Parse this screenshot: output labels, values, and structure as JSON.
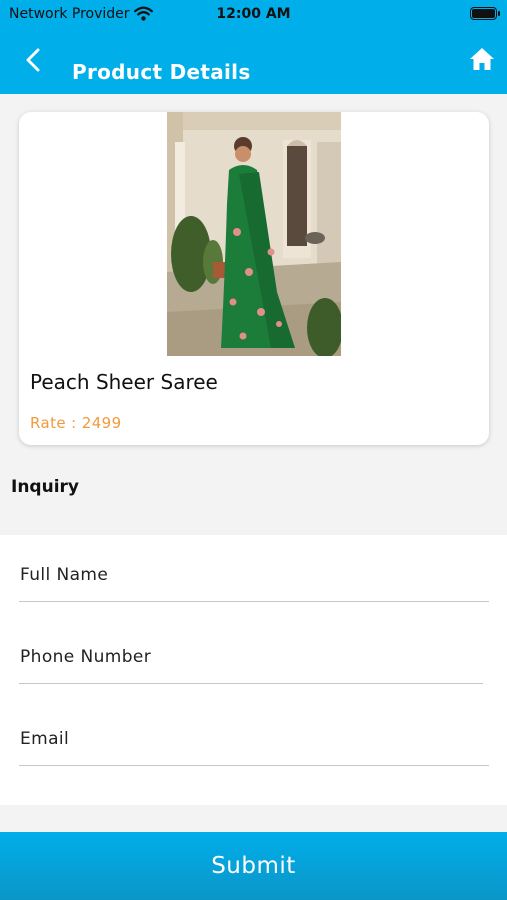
{
  "status_bar": {
    "carrier": "Network Provider",
    "time": "12:00 AM"
  },
  "header": {
    "title": "Product Details"
  },
  "product": {
    "name": "Peach Sheer Saree",
    "rate": "Rate : 2499"
  },
  "inquiry": {
    "label": "Inquiry",
    "fields": [
      {
        "placeholder": "Full Name",
        "value": ""
      },
      {
        "placeholder": "Phone Number",
        "value": ""
      },
      {
        "placeholder": "Email",
        "value": ""
      }
    ],
    "submit_label": "Submit"
  },
  "colors": {
    "header_bg": "#00aeea",
    "rate_text": "#f29a3b",
    "page_bg": "#f3f3f3"
  },
  "icons": {
    "back": "chevron-left-icon",
    "home": "home-icon",
    "wifi": "wifi-icon",
    "battery": "battery-icon"
  }
}
